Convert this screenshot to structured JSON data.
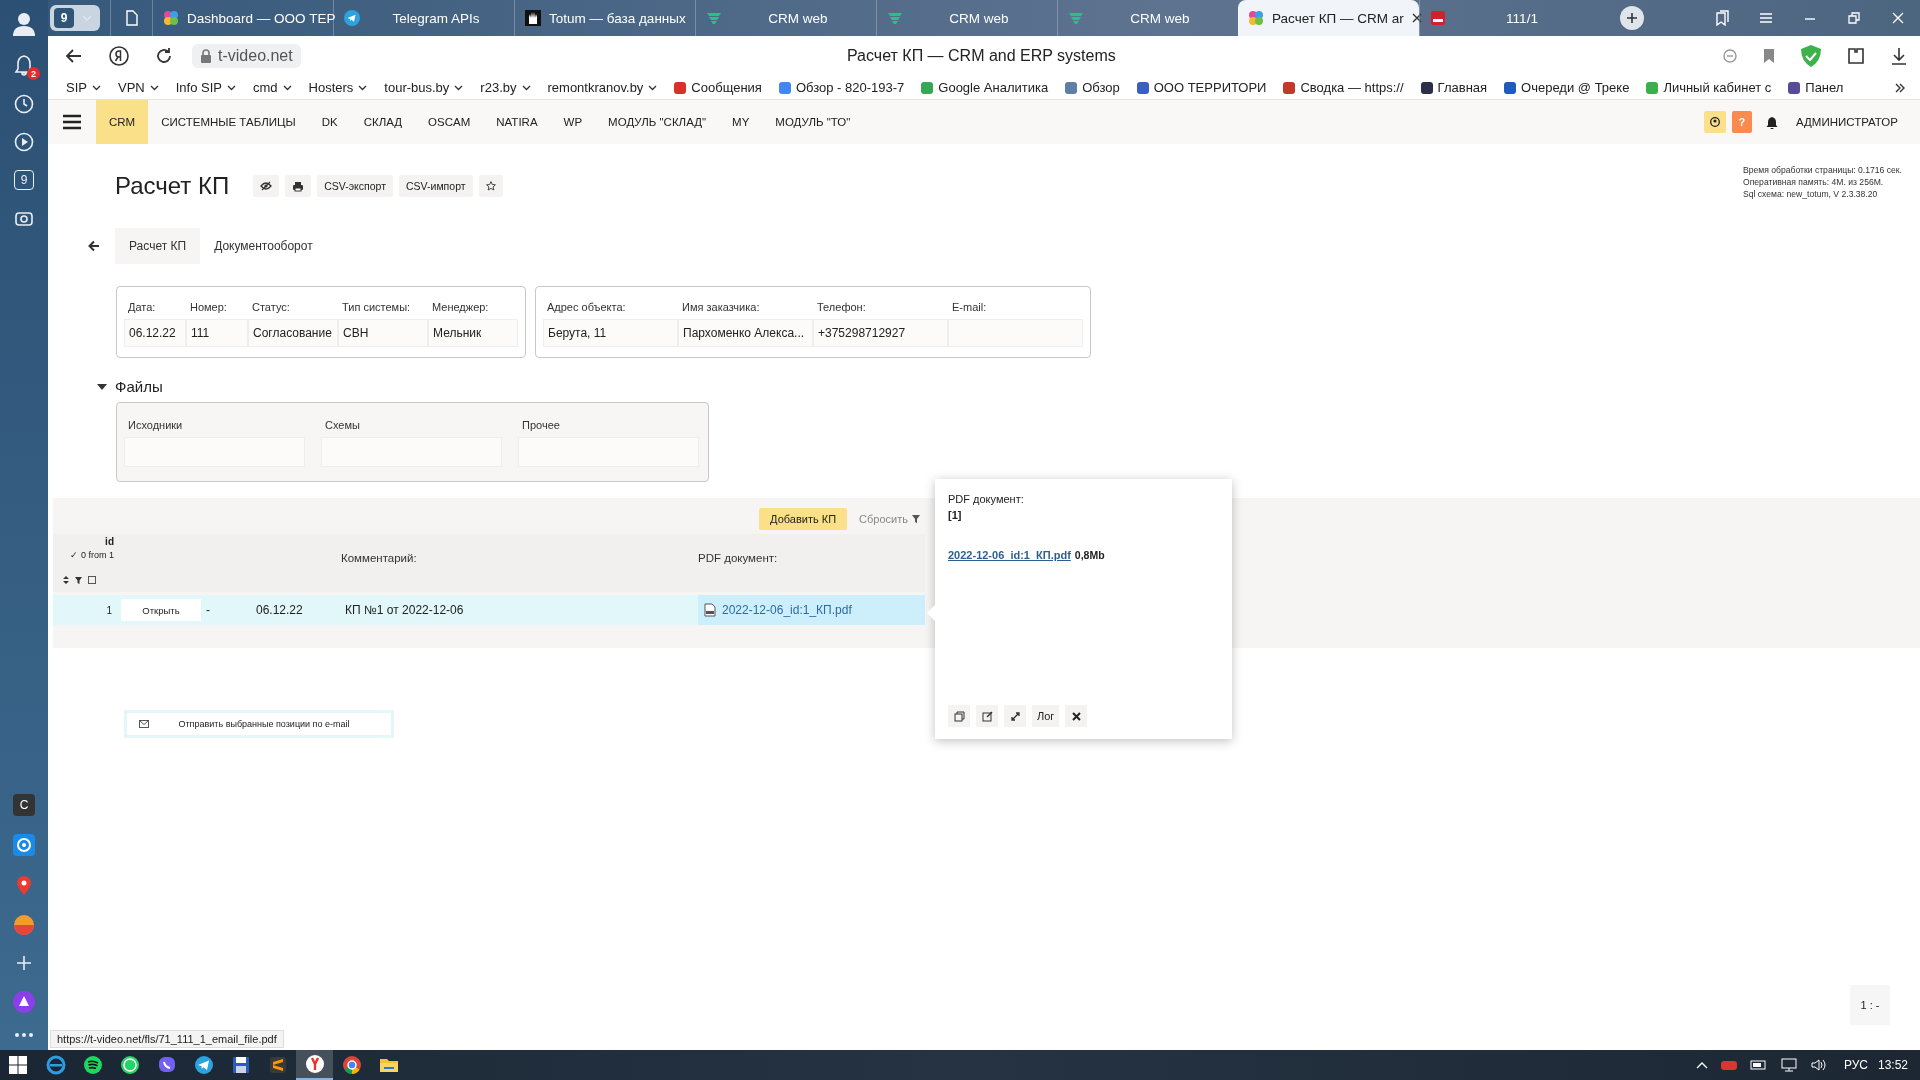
{
  "browser": {
    "sidebar": {
      "notification_count": "2",
      "counter": "9",
      "app_letter": "C"
    },
    "tab_count": "9",
    "tabs": [
      {
        "kind": "page",
        "selected": false
      },
      {
        "kind": "pinwheel",
        "title": "Dashboard — ООО ТЕР",
        "selected": false
      },
      {
        "kind": "telegram",
        "title": "Telegram APIs",
        "selected": false
      },
      {
        "kind": "hand",
        "title": "Totum — база данных",
        "selected": false
      },
      {
        "kind": "crm",
        "title": "CRM web",
        "selected": false
      },
      {
        "kind": "crm",
        "title": "CRM web",
        "selected": false
      },
      {
        "kind": "crm",
        "title": "CRM web",
        "selected": false
      },
      {
        "kind": "pinwheel",
        "title": "Расчет КП — CRM ar",
        "selected": true
      },
      {
        "kind": "pdf",
        "title": "111/1",
        "selected": false
      }
    ],
    "address": {
      "domain": "t-video.net",
      "page_title": "Расчет КП — CRM and ERP systems"
    },
    "bookmarks": [
      {
        "label": "SIP",
        "folder": true
      },
      {
        "label": "VPN",
        "folder": true
      },
      {
        "label": "Info SIP",
        "folder": true
      },
      {
        "label": "cmd",
        "folder": true
      },
      {
        "label": "Hosters",
        "folder": true
      },
      {
        "label": "tour-bus.by",
        "folder": true
      },
      {
        "label": "r23.by",
        "folder": true
      },
      {
        "label": "remontkranov.by",
        "folder": true
      },
      {
        "label": "Сообщения",
        "folder": false,
        "color": "#d8312a"
      },
      {
        "label": "Обзор - 820-193-7",
        "folder": false,
        "color": "#4285f4"
      },
      {
        "label": "Google Аналитика",
        "folder": false,
        "color": "#34a853"
      },
      {
        "label": "Обзор",
        "folder": false,
        "color": "#5f7fa8"
      },
      {
        "label": "ООО ТЕРРИТОРИ",
        "folder": false,
        "color": "#3b5fc0"
      },
      {
        "label": "Сводка — https://",
        "folder": false,
        "color": "#c0392b"
      },
      {
        "label": "Главная",
        "folder": false,
        "color": "#2b2f4a"
      },
      {
        "label": "Очереди @ Треке",
        "folder": false,
        "color": "#1e5bbf"
      },
      {
        "label": "Личный кабинет с",
        "folder": false,
        "color": "#3cae4c"
      },
      {
        "label": "Панел",
        "folder": false,
        "color": "#5a4a9a"
      }
    ],
    "status_url": "https://t-video.net/fls/71_111_1_email_file.pdf"
  },
  "app": {
    "nav": [
      {
        "label": "CRM",
        "selected": true
      },
      {
        "label": "СИСТЕМНЫЕ ТАБЛИЦЫ",
        "selected": false
      },
      {
        "label": "DK",
        "selected": false
      },
      {
        "label": "СКЛАД",
        "selected": false
      },
      {
        "label": "OSCAM",
        "selected": false
      },
      {
        "label": "NATIRA",
        "selected": false
      },
      {
        "label": "WP",
        "selected": false
      },
      {
        "label": "МОДУЛЬ \"СКЛАД\"",
        "selected": false
      },
      {
        "label": "MY",
        "selected": false
      },
      {
        "label": "МОДУЛЬ \"ТО\"",
        "selected": false
      }
    ],
    "help": "?",
    "user": "АДМИНИСТРАТОР",
    "page_title": "Расчет КП",
    "toolbar": [
      "CSV-экспорт",
      "CSV-импорт"
    ],
    "info": [
      "Время обработки страницы: 0.1716 сек.",
      "Оперативная память: 4M. из 256M.",
      "Sql схема: new_totum, V 2.3.38.20"
    ],
    "tabs": [
      {
        "label": "Расчет КП",
        "selected": true
      },
      {
        "label": "Документооборот",
        "selected": false
      }
    ],
    "field_groups": [
      [
        {
          "label": "Дата:",
          "value": "06.12.22"
        },
        {
          "label": "Номер:",
          "value": "111"
        },
        {
          "label": "Статус:",
          "value": "Согласование"
        },
        {
          "label": "Тип системы:",
          "value": "СВН"
        },
        {
          "label": "Менеджер:",
          "value": "Мельник"
        }
      ],
      [
        {
          "label": "Адрес объекта:",
          "value": "Берута, 11"
        },
        {
          "label": "Имя заказчика:",
          "value": "Пархоменко Алекса..."
        },
        {
          "label": "Телефон:",
          "value": "+375298712927"
        },
        {
          "label": "E-mail:"
        }
      ]
    ],
    "files": {
      "title": "Файлы",
      "expanded": true,
      "fields": [
        "Исходники",
        "Схемы",
        "Прочее"
      ]
    },
    "table": {
      "add_button": "Добавить КП",
      "reset_button": "Сбросить",
      "id_header": "id",
      "selection_count": "✓ 0 from 1",
      "columns": [
        "Комментарий:",
        "PDF документ:"
      ],
      "rows": [
        {
          "id": "1",
          "open_button": "Открыть",
          "column_3": "-",
          "date": "06.12.22",
          "comment": "КП №1 от 2022-12-06",
          "pdf": "2022-12-06_id:1_КП.pdf",
          "selected": true
        }
      ]
    },
    "popup": {
      "label": "PDF документ:",
      "index": "[1]",
      "file": "2022-12-06_id:1_КП.pdf",
      "size": "0,8Mb",
      "log_button": "Лог"
    },
    "email_button": "Отправить выбранные позиции по e-mail",
    "page_counter": "1 : -"
  },
  "taskbar": {
    "apps": [
      {
        "kind": "ie",
        "selected": false
      },
      {
        "kind": "spotify",
        "selected": false
      },
      {
        "kind": "whatsapp",
        "selected": false
      },
      {
        "kind": "viber",
        "selected": false
      },
      {
        "kind": "telegram",
        "selected": false
      },
      {
        "kind": "disk",
        "selected": false
      },
      {
        "kind": "sublime",
        "selected": false
      },
      {
        "kind": "yandex",
        "selected": true
      },
      {
        "kind": "chrome",
        "selected": false
      },
      {
        "kind": "folder",
        "selected": false
      }
    ],
    "language": "РУС",
    "time": "13:52"
  }
}
